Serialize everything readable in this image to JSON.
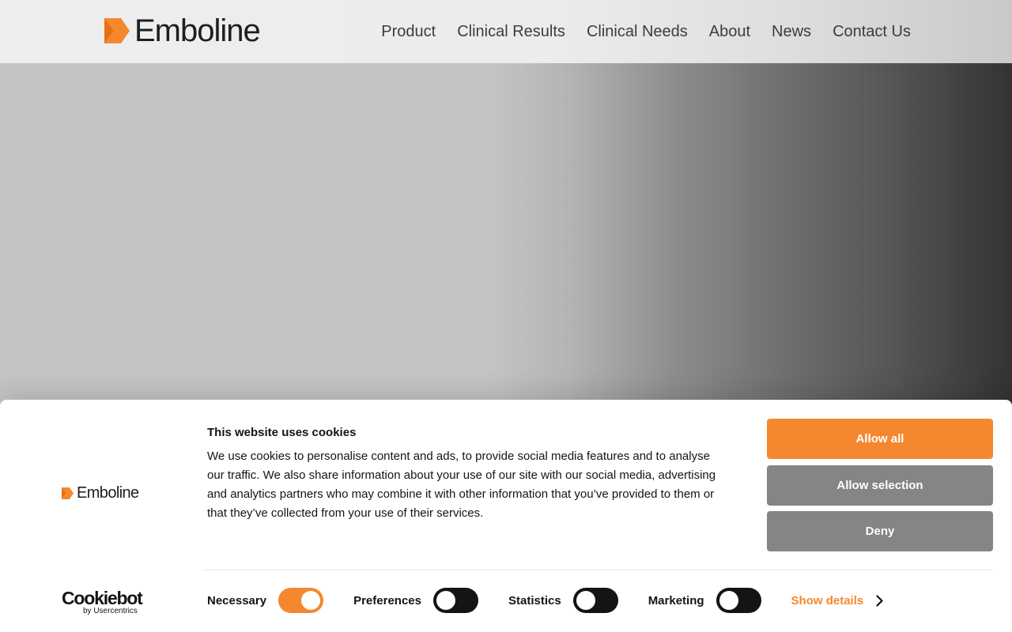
{
  "header": {
    "brand_name": "Emboline",
    "nav": [
      "Product",
      "Clinical Results",
      "Clinical Needs",
      "About",
      "News",
      "Contact Us"
    ]
  },
  "cookie_banner": {
    "brand_name": "Emboline",
    "title": "This website uses cookies",
    "text": "We use cookies to personalise content and ads, to provide social media features and to analyse our traffic. We also share information about your use of our site with our social media, advertising and analytics partners who may combine it with other information that you’ve provided to them or that they’ve collected from your use of their services.",
    "buttons": {
      "allow_all": "Allow all",
      "allow_selection": "Allow selection",
      "deny": "Deny"
    },
    "provider": {
      "name": "Cookiebot",
      "sub": "by Usercentrics"
    },
    "categories": [
      {
        "label": "Necessary",
        "enabled": true
      },
      {
        "label": "Preferences",
        "enabled": false
      },
      {
        "label": "Statistics",
        "enabled": false
      },
      {
        "label": "Marketing",
        "enabled": false
      }
    ],
    "show_details": "Show details"
  },
  "colors": {
    "accent": "#f5882e",
    "button_gray": "#858585",
    "text_dark": "#141414"
  },
  "icons": [
    "emboline-logo-icon",
    "chevron-right-icon"
  ]
}
